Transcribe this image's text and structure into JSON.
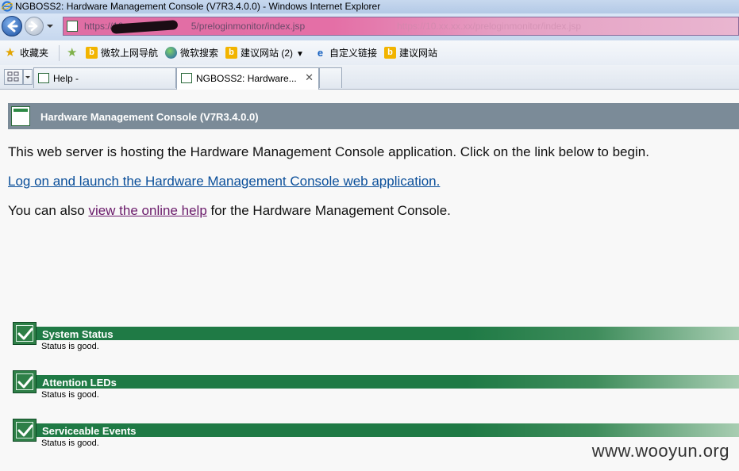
{
  "window": {
    "title": "NGBOSS2: Hardware Management Console (V7R3.4.0.0) - Windows Internet Explorer"
  },
  "address_bar": {
    "url_prefix": "https://",
    "url_host_visible": "10.",
    "url_rest": "5/preloginmonitor/index.jsp",
    "ghost_text": "https://10.xx.xx.xx/preloginmonitor/index.jsp"
  },
  "favorites_bar": {
    "favorites_label": "收藏夹",
    "items": [
      {
        "label": "微软上网导航",
        "icon": "bing-icon"
      },
      {
        "label": "微软搜索",
        "icon": "globe-icon"
      },
      {
        "label": "建议网站 (2)",
        "icon": "bing-icon"
      },
      {
        "label": "自定义链接",
        "icon": "ie-page-icon"
      },
      {
        "label": "建议网站",
        "icon": "bing-icon"
      }
    ]
  },
  "tabs": [
    {
      "label": "Help -",
      "active": false
    },
    {
      "label": "NGBOSS2: Hardware...",
      "active": true
    }
  ],
  "page": {
    "header_title": "Hardware Management Console (V7R3.4.0.0)",
    "intro_text": "This web server is hosting the Hardware Management Console application.  Click on the link below to begin.",
    "launch_link": "Log on and launch the Hardware Management Console web application.",
    "help_prefix": "You can also ",
    "help_link": "view the online help",
    "help_suffix": " for the Hardware Management Console."
  },
  "status_items": [
    {
      "name": "System Status",
      "description": "Status is good."
    },
    {
      "name": "Attention LEDs",
      "description": "Status is good."
    },
    {
      "name": "Serviceable Events",
      "description": "Status is good."
    }
  ],
  "watermark": "www.wooyun.org",
  "colors": {
    "header_bg": "#7b8b98",
    "status_green": "#1f7a45",
    "link_blue": "#0b4f9a",
    "link_visited": "#6a1a6a"
  }
}
